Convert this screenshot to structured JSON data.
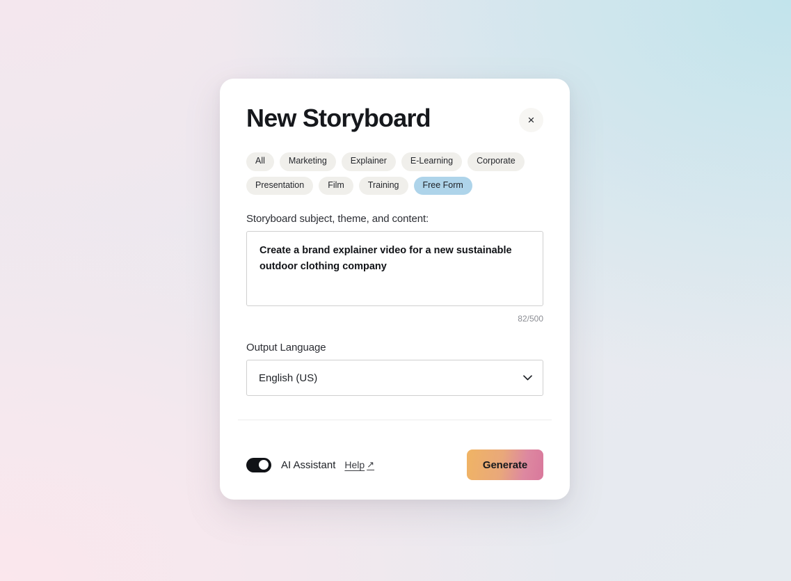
{
  "modal": {
    "title": "New Storyboard",
    "close_icon_label": "×",
    "categories": [
      {
        "label": "All",
        "selected": false
      },
      {
        "label": "Marketing",
        "selected": false
      },
      {
        "label": "Explainer",
        "selected": false
      },
      {
        "label": "E-Learning",
        "selected": false
      },
      {
        "label": "Corporate",
        "selected": false
      },
      {
        "label": "Presentation",
        "selected": false
      },
      {
        "label": "Film",
        "selected": false
      },
      {
        "label": "Training",
        "selected": false
      },
      {
        "label": "Free Form",
        "selected": true
      }
    ],
    "subject": {
      "label": "Storyboard subject, theme, and content:",
      "value": "Create a brand explainer video for a new sustainable outdoor clothing company",
      "placeholder": "",
      "char_counter": "82/500",
      "char_count": 82,
      "char_limit": 500
    },
    "language": {
      "label": "Output Language",
      "selected": "English (US)",
      "options": [
        "English (US)"
      ],
      "chevron_icon": "chevron-down"
    },
    "footer": {
      "toggle_label": "AI Assistant",
      "toggle_on": true,
      "help_label": "Help",
      "help_arrow": "↗",
      "generate_label": "Generate"
    }
  },
  "colors": {
    "chip_background": "#f0efeb",
    "chip_selected_background": "#aed4ea",
    "toggle_on": "#111317",
    "generate_gradient_start": "#f0b464",
    "generate_gradient_end": "#d9789c",
    "card_background": "#ffffff",
    "backdrop_aqua": "#c2e4ec",
    "backdrop_pink": "#fbe7ed"
  }
}
